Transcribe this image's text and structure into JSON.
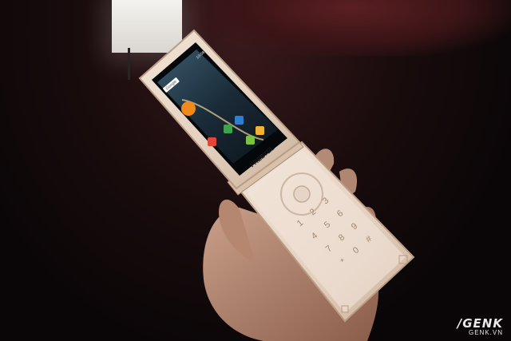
{
  "brand": {
    "text": "FREETEL"
  },
  "screen": {
    "search_text": "Google",
    "status_time": "10:08"
  },
  "keypad": {
    "keys": [
      "1",
      "2",
      "3",
      "4",
      "5",
      "6",
      "7",
      "8",
      "9",
      "*",
      "0",
      "#"
    ]
  },
  "watermark": {
    "logo": "GENK",
    "logo_prefix": "/",
    "site": "GENK.VN"
  },
  "colors": {
    "phone_gold": "#e8d6c6",
    "screen_dark": "#101820",
    "accent_orange": "#f08a1a"
  }
}
